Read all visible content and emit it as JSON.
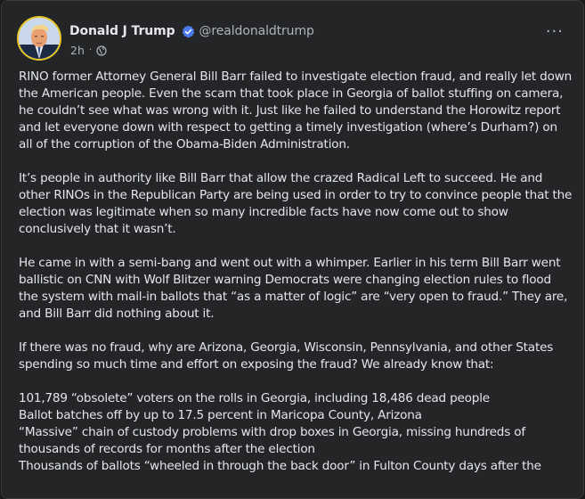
{
  "post": {
    "author_name": "Donald J Trump",
    "handle": "@realdonaldtrump",
    "time": "2h",
    "separator": "·",
    "audience_icon": "globe-icon",
    "menu_label": "···",
    "paragraphs": [
      "RINO former Attorney General Bill Barr failed to investigate election fraud, and really let down the American people. Even the scam that took place in Georgia of ballot stuffing on camera, he couldn’t see what was wrong with it. Just like he failed to understand the Horowitz report and let everyone down with respect to getting a timely investigation (where’s Durham?) on all of the corruption of the Obama-Biden Administration.",
      "It’s people in authority like Bill Barr that allow the crazed Radical Left to succeed. He and other RINOs in the Republican Party are being used in order to try to convince people that the election was legitimate when so many incredible facts have now come out to show conclusively that it wasn’t.",
      "He came in with a semi-bang and went out with a whimper. Earlier in his term Bill Barr went ballistic on CNN with Wolf Blitzer warning Democrats were changing election rules to flood the system with mail-in ballots that “as a matter of logic” are “very open to fraud.” They are, and Bill Barr did nothing about it.",
      "If there was no fraud, why are Arizona, Georgia, Wisconsin, Pennsylvania, and other States spending so much time and effort on exposing the fraud? We already know that:"
    ],
    "list_lines": [
      "101,789 “obsolete” voters on the rolls in Georgia, including 18,486 dead people",
      "Ballot batches off by up to 17.5 percent in Maricopa County, Arizona",
      "“Massive” chain of custody problems with drop boxes in Georgia, missing hundreds of thousands of records for months after the election",
      "Thousands of ballots “wheeled in through the back door” in Fulton County days after the"
    ]
  },
  "colors": {
    "page_bg": "#18191a",
    "card_bg": "#242526",
    "text_primary": "#e4e6eb",
    "text_secondary": "#b0b3b8",
    "verified_blue": "#4b7bec",
    "avatar_ring": "#e7c62a"
  },
  "icons": {
    "verified": "verified-badge-icon",
    "more": "more-options-icon",
    "avatar": "profile-photo"
  }
}
